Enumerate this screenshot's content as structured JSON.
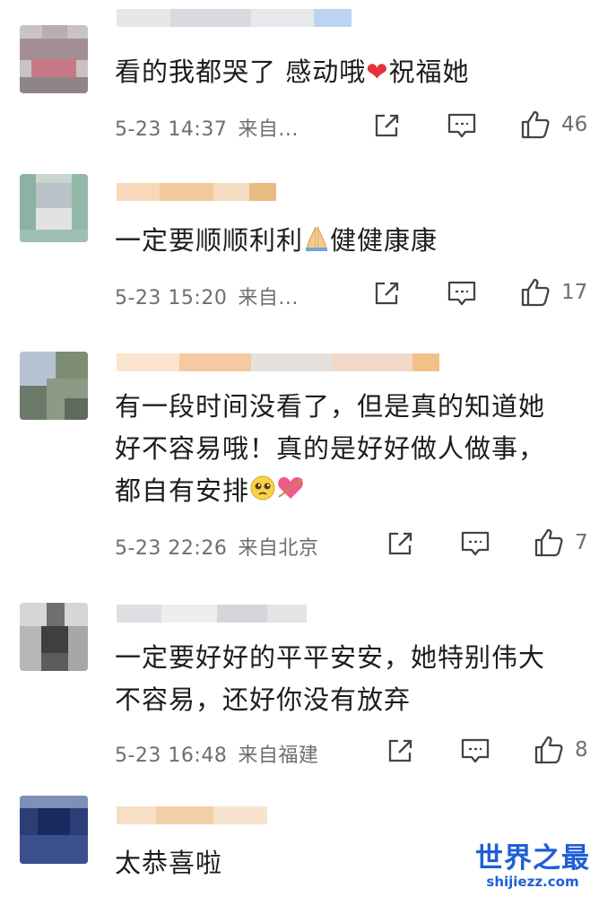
{
  "comments": [
    {
      "avatar": "pixelated-avatar",
      "text_before_heart": "看的我都哭了 感动哦",
      "heart": "❤",
      "text_after_heart": "祝福她",
      "time": "5-23 14:37",
      "location": "来自...",
      "likes": "46"
    },
    {
      "avatar": "pixelated-avatar",
      "text_before_emoji": "一定要顺顺利利",
      "emoji": "🙏",
      "text_after_emoji": "健健康康",
      "time": "5-23 15:20",
      "location": "来自...",
      "likes": "17"
    },
    {
      "avatar": "pixelated-avatar",
      "lines": [
        "有一段时间没看了，但是真的知道她",
        "好不容易哦！真的是好好做人做事，",
        "都自有安排"
      ],
      "emoji_1": "🥺",
      "emoji_2": "💘",
      "time": "5-23 22:26",
      "location": "来自北京",
      "likes": "7"
    },
    {
      "avatar": "pixelated-avatar",
      "lines": [
        "一定要好好的平平安安，她特别伟大",
        "不容易，还好你没有放弃"
      ],
      "time": "5-23 16:48",
      "location": "来自福建",
      "likes": "8"
    },
    {
      "avatar": "pixelated-avatar",
      "text": "太恭喜啦"
    }
  ],
  "icons": {
    "share": "share-icon",
    "reply": "comment-icon",
    "like": "thumbs-up-icon"
  },
  "colors": {
    "meta_text": "#6e6e6e",
    "heart": "#e5303a",
    "watermark": "#1f5fd6"
  },
  "watermark": {
    "title": "世界之最",
    "url": "shijiezz.com"
  }
}
